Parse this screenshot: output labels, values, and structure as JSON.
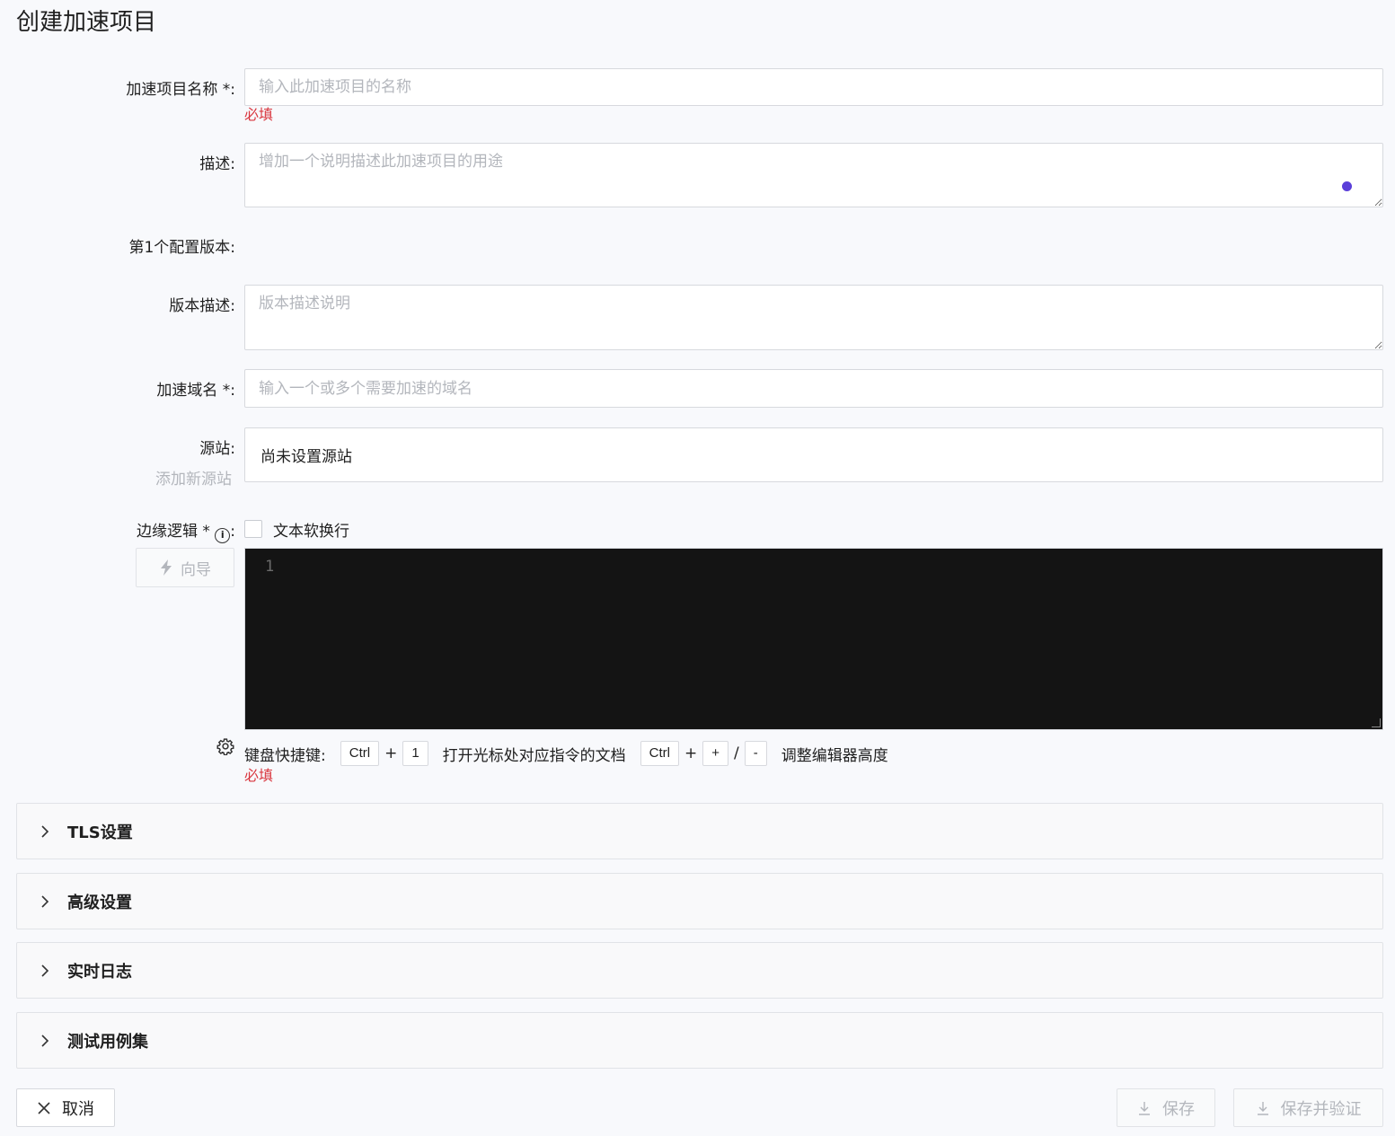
{
  "page": {
    "title": "创建加速项目"
  },
  "form": {
    "name": {
      "label": "加速项目名称 *:",
      "placeholder": "输入此加速项目的名称",
      "error": "必填"
    },
    "description": {
      "label": "描述:",
      "placeholder": "增加一个说明描述此加速项目的用途"
    },
    "config_version": {
      "label": "第1个配置版本:"
    },
    "version_description": {
      "label": "版本描述:",
      "placeholder": "版本描述说明"
    },
    "domains": {
      "label": "加速域名 *:",
      "placeholder": "输入一个或多个需要加速的域名"
    },
    "origin": {
      "label": "源站:",
      "value": "尚未设置源站",
      "add_link": "添加新源站"
    },
    "edge_logic": {
      "label": "边缘逻辑 *",
      "info_glyph": "i",
      "colon": ":",
      "soft_wrap_label": "文本软换行",
      "wizard_label": "向导",
      "line_number": "1",
      "error": "必填"
    },
    "shortcuts": {
      "prefix": "键盘快捷键:",
      "key_ctrl": "Ctrl",
      "plus": "+",
      "key_1": "1",
      "doc_text": "打开光标处对应指令的文档",
      "key_plus": "+",
      "slash": "/",
      "key_minus": "-",
      "height_text": "调整编辑器高度"
    }
  },
  "panels": [
    {
      "title": "TLS设置"
    },
    {
      "title": "高级设置"
    },
    {
      "title": "实时日志"
    },
    {
      "title": "测试用例集"
    }
  ],
  "actions": {
    "cancel": "取消",
    "save": "保存",
    "save_verify": "保存并验证"
  },
  "colors": {
    "error": "#d9363e",
    "editor_bg": "#141414",
    "accent_dot": "#5b3fd9"
  }
}
